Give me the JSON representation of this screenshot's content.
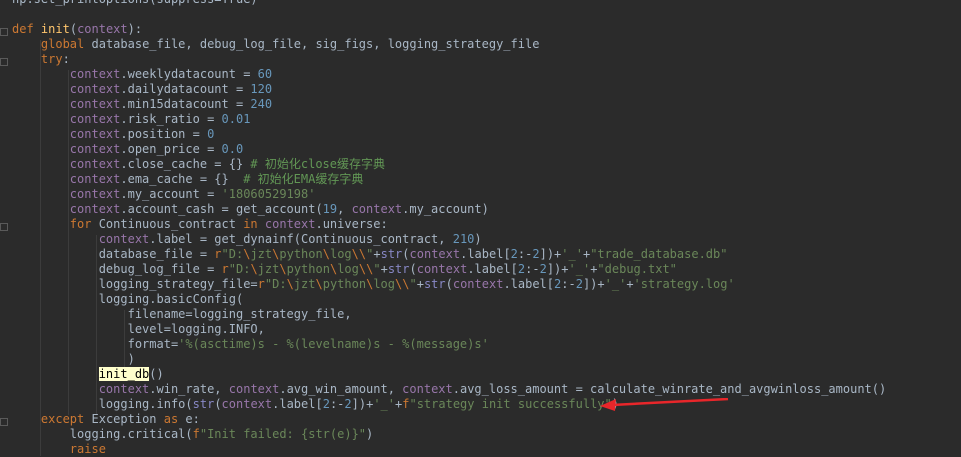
{
  "editor": {
    "lines": [
      "np.set_printoptions(suppress=True)",
      "",
      "def init(context):",
      "    global database_file, debug_log_file, sig_figs, logging_strategy_file",
      "    try:",
      "        context.weeklydatacount = 60",
      "        context.dailydatacount = 120",
      "        context.min15datacount = 240",
      "        context.risk_ratio = 0.01",
      "        context.position = 0",
      "        context.open_price = 0.0",
      "        context.close_cache = {} # 初始化close缓存字典",
      "        context.ema_cache = {}  # 初始化EMA缓存字典",
      "        context.my_account = '18060529198'",
      "        context.account_cash = get_account(19, context.my_account)",
      "        for Continuous_contract in context.universe:",
      "            context.label = get_dynainf(Continuous_contract, 210)",
      "            database_file = r\"D:\\jzt\\python\\log\\\\\"+str(context.label[2:-2])+'_'+\"trade_database.db\"",
      "            debug_log_file = r\"D:\\jzt\\python\\log\\\\\"+str(context.label[2:-2])+'_'+\"debug.txt\"",
      "            logging_strategy_file=r\"D:\\jzt\\python\\log\\\\\"+str(context.label[2:-2])+'_'+'strategy.log'",
      "            logging.basicConfig(",
      "                filename=logging_strategy_file,",
      "                level=logging.INFO,",
      "                format='%(asctime)s - %(levelname)s - %(message)s'",
      "                )",
      "            init_db()",
      "            context.win_rate, context.avg_win_amount, context.avg_loss_amount = calculate_winrate_and_avgwinloss_amount()",
      "            logging.info(str(context.label[2:-2])+'_'+f\"strategy init successfully\")",
      "    except Exception as e:",
      "        logging.critical(f\"Init failed: {str(e)}\")",
      "        raise"
    ]
  },
  "colors": {
    "background": "#2b2b2b",
    "default_text": "#a9b7c6",
    "keyword": "#cc7832",
    "context": "#9876aa",
    "number": "#6897bb",
    "string": "#6a8759",
    "comment": "#629755",
    "function_def": "#ffc66d",
    "builtin": "#8888c6",
    "highlight_bg": "#ffffcc",
    "annotation_arrow": "#e8262a"
  },
  "highlight": {
    "line_index": 25,
    "text": "init_db"
  },
  "annotation": {
    "icon": "red-arrow-icon",
    "points_to_line_index": 27
  }
}
